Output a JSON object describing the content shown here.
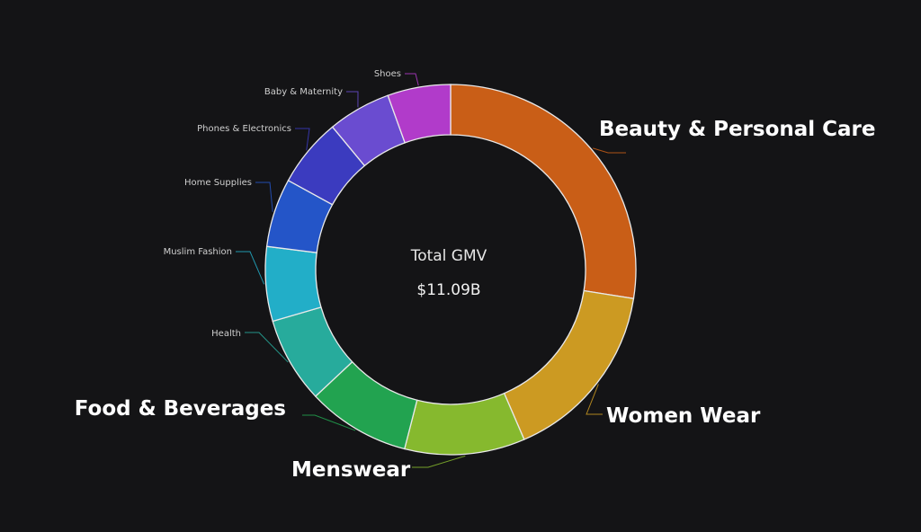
{
  "chart_data": {
    "type": "pie",
    "center_title": "Total GMV",
    "center_value": "$11.09B",
    "slices": [
      {
        "label": "Beauty & Personal Care",
        "value": 27.5,
        "color": "#c95e17"
      },
      {
        "label": "Women Wear",
        "value": 16.0,
        "color": "#cc9a22"
      },
      {
        "label": "Menswear",
        "value": 10.5,
        "color": "#86b92e"
      },
      {
        "label": "Food & Beverages",
        "value": 9.0,
        "color": "#22a350"
      },
      {
        "label": "Health",
        "value": 7.5,
        "color": "#27ab9c"
      },
      {
        "label": "Muslim Fashion",
        "value": 6.5,
        "color": "#22aec8"
      },
      {
        "label": "Home Supplies",
        "value": 6.0,
        "color": "#2455c8"
      },
      {
        "label": "Phones & Electronics",
        "value": 6.0,
        "color": "#3b3bbf"
      },
      {
        "label": "Baby & Maternity",
        "value": 5.5,
        "color": "#6a4cd0"
      },
      {
        "label": "Shoes",
        "value": 5.5,
        "color": "#b13bca"
      }
    ]
  }
}
